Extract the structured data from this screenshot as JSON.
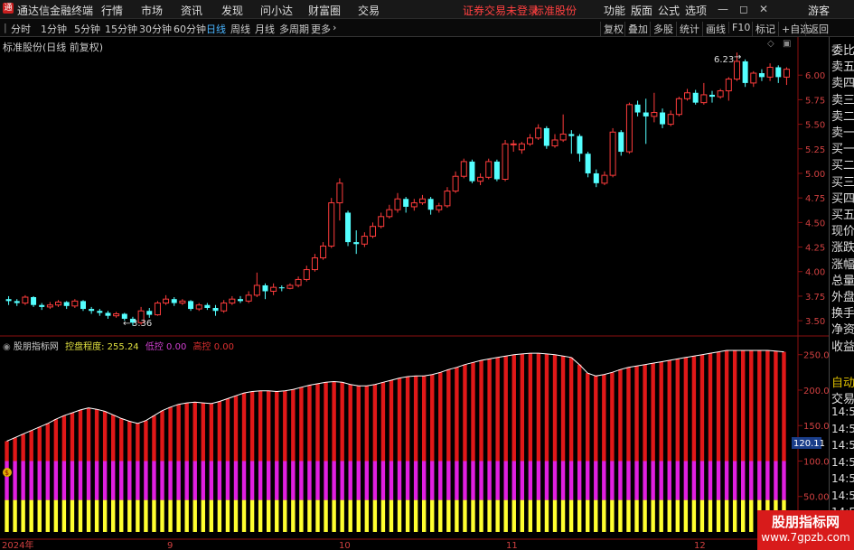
{
  "menubar": {
    "app_title": "通达信金融终端",
    "items": [
      "行情",
      "市场",
      "资讯",
      "发现",
      "问小达",
      "财富圈",
      "交易"
    ],
    "notice": "证券交易未登录",
    "stock_name": "标准股份",
    "right_items": [
      "功能",
      "版面",
      "公式",
      "选项"
    ],
    "guest": "游客"
  },
  "periods": {
    "items": [
      "分时",
      "1分钟",
      "5分钟",
      "15分钟",
      "30分钟",
      "60分钟",
      "日线",
      "周线",
      "月线",
      "多周期",
      "更多"
    ],
    "active": "日线"
  },
  "tools": [
    "复权",
    "叠加",
    "多股",
    "统计",
    "画线",
    "F10",
    "标记",
    "+自选",
    "返回"
  ],
  "price_chart": {
    "header": "标准股份(日线 前复权)",
    "high_label": "6.23",
    "low_label": "3.36",
    "y_ticks": [
      "6.00",
      "5.75",
      "5.50",
      "5.25",
      "5.00",
      "4.75",
      "4.50",
      "4.25",
      "4.00",
      "3.75",
      "3.50"
    ]
  },
  "indicator": {
    "name": "股朋指标网",
    "kpcd_label": "控盘程度:",
    "kpcd_value": "255.24",
    "low_label": "低控",
    "low_value": "0.00",
    "high_label": "高控",
    "high_value": "0.00",
    "y_ticks": [
      "250.0",
      "200.0",
      "150.0",
      "100.0",
      "50.00"
    ],
    "current_tag": "120.11"
  },
  "x_labels": [
    "2024年",
    "9",
    "10",
    "11",
    "12"
  ],
  "sidebar": {
    "items": [
      "委比",
      "卖五",
      "卖四",
      "卖三",
      "卖二",
      "卖一",
      "买一",
      "买二",
      "买三",
      "买四",
      "买五",
      "现价",
      "涨跌",
      "涨幅",
      "总量",
      "外盘",
      "换手",
      "净资",
      "收益"
    ],
    "bottom_items": [
      "自动",
      "交易"
    ],
    "times": [
      "14:56",
      "14:56",
      "14:56",
      "14:56",
      "14:56",
      "14:56",
      "14:56"
    ]
  },
  "watermark": {
    "line1": "股朋指标网",
    "line2": "www.7gpzb.com"
  },
  "chart_data": {
    "type": "candlestick",
    "candles": [
      [
        3.72,
        3.7,
        3.75,
        3.66
      ],
      [
        3.7,
        3.68,
        3.72,
        3.65
      ],
      [
        3.68,
        3.74,
        3.76,
        3.66
      ],
      [
        3.74,
        3.66,
        3.75,
        3.64
      ],
      [
        3.66,
        3.64,
        3.68,
        3.61
      ],
      [
        3.64,
        3.66,
        3.69,
        3.62
      ],
      [
        3.66,
        3.69,
        3.71,
        3.64
      ],
      [
        3.69,
        3.65,
        3.7,
        3.62
      ],
      [
        3.65,
        3.7,
        3.72,
        3.63
      ],
      [
        3.7,
        3.62,
        3.71,
        3.6
      ],
      [
        3.62,
        3.6,
        3.64,
        3.57
      ],
      [
        3.6,
        3.58,
        3.62,
        3.55
      ],
      [
        3.58,
        3.55,
        3.6,
        3.52
      ],
      [
        3.55,
        3.57,
        3.59,
        3.53
      ],
      [
        3.57,
        3.52,
        3.58,
        3.5
      ],
      [
        3.52,
        3.48,
        3.54,
        3.45
      ],
      [
        3.48,
        3.6,
        3.64,
        3.46
      ],
      [
        3.6,
        3.56,
        3.63,
        3.53
      ],
      [
        3.56,
        3.68,
        3.7,
        3.55
      ],
      [
        3.68,
        3.72,
        3.76,
        3.66
      ],
      [
        3.72,
        3.68,
        3.74,
        3.65
      ],
      [
        3.68,
        3.7,
        3.72,
        3.66
      ],
      [
        3.7,
        3.62,
        3.71,
        3.6
      ],
      [
        3.62,
        3.66,
        3.68,
        3.6
      ],
      [
        3.66,
        3.63,
        3.68,
        3.61
      ],
      [
        3.63,
        3.6,
        3.66,
        3.55
      ],
      [
        3.6,
        3.68,
        3.71,
        3.58
      ],
      [
        3.68,
        3.72,
        3.75,
        3.66
      ],
      [
        3.72,
        3.7,
        3.75,
        3.68
      ],
      [
        3.7,
        3.76,
        3.8,
        3.68
      ],
      [
        3.76,
        3.86,
        3.99,
        3.74
      ],
      [
        3.86,
        3.8,
        3.88,
        3.72
      ],
      [
        3.8,
        3.84,
        3.88,
        3.76
      ],
      [
        3.84,
        3.83,
        3.86,
        3.8
      ],
      [
        3.83,
        3.86,
        3.88,
        3.82
      ],
      [
        3.86,
        3.92,
        3.95,
        3.84
      ],
      [
        3.92,
        4.02,
        4.06,
        3.9
      ],
      [
        4.02,
        4.14,
        4.18,
        4.0
      ],
      [
        4.14,
        4.26,
        4.3,
        4.12
      ],
      [
        4.26,
        4.7,
        4.75,
        4.24
      ],
      [
        4.7,
        4.9,
        4.95,
        4.52
      ],
      [
        4.6,
        4.3,
        4.62,
        4.26
      ],
      [
        4.3,
        4.28,
        4.42,
        4.18
      ],
      [
        4.28,
        4.36,
        4.4,
        4.25
      ],
      [
        4.36,
        4.46,
        4.5,
        4.34
      ],
      [
        4.46,
        4.56,
        4.6,
        4.44
      ],
      [
        4.56,
        4.63,
        4.68,
        4.54
      ],
      [
        4.63,
        4.74,
        4.8,
        4.6
      ],
      [
        4.74,
        4.66,
        4.76,
        4.6
      ],
      [
        4.66,
        4.7,
        4.74,
        4.62
      ],
      [
        4.7,
        4.74,
        4.78,
        4.68
      ],
      [
        4.74,
        4.63,
        4.76,
        4.58
      ],
      [
        4.63,
        4.67,
        4.7,
        4.6
      ],
      [
        4.67,
        4.82,
        4.86,
        4.65
      ],
      [
        4.82,
        4.97,
        5.02,
        4.8
      ],
      [
        4.97,
        5.12,
        5.15,
        4.95
      ],
      [
        5.12,
        4.92,
        5.14,
        4.9
      ],
      [
        4.92,
        4.96,
        5.0,
        4.88
      ],
      [
        4.96,
        5.12,
        5.15,
        4.94
      ],
      [
        5.12,
        4.94,
        5.14,
        4.92
      ],
      [
        4.94,
        5.3,
        5.34,
        4.92
      ],
      [
        5.3,
        5.3,
        5.34,
        5.22
      ],
      [
        5.24,
        5.3,
        5.32,
        5.2
      ],
      [
        5.3,
        5.36,
        5.4,
        5.28
      ],
      [
        5.36,
        5.46,
        5.5,
        5.34
      ],
      [
        5.46,
        5.28,
        5.48,
        5.25
      ],
      [
        5.28,
        5.34,
        5.4,
        5.26
      ],
      [
        5.34,
        5.4,
        5.6,
        5.32
      ],
      [
        5.4,
        5.38,
        5.44,
        5.2
      ],
      [
        5.38,
        5.2,
        5.4,
        5.12
      ],
      [
        5.2,
        5.0,
        5.22,
        4.96
      ],
      [
        5.0,
        4.9,
        5.04,
        4.86
      ],
      [
        4.9,
        4.98,
        5.02,
        4.88
      ],
      [
        4.98,
        5.42,
        5.46,
        4.96
      ],
      [
        5.42,
        5.22,
        5.44,
        5.18
      ],
      [
        5.22,
        5.7,
        5.72,
        5.2
      ],
      [
        5.7,
        5.62,
        5.74,
        5.58
      ],
      [
        5.62,
        5.58,
        5.76,
        5.3
      ],
      [
        5.58,
        5.62,
        5.82,
        5.52
      ],
      [
        5.62,
        5.5,
        5.66,
        5.46
      ],
      [
        5.5,
        5.6,
        5.64,
        5.48
      ],
      [
        5.6,
        5.76,
        5.78,
        5.58
      ],
      [
        5.76,
        5.82,
        5.86,
        5.74
      ],
      [
        5.82,
        5.72,
        5.85,
        5.7
      ],
      [
        5.72,
        5.8,
        5.92,
        5.7
      ],
      [
        5.8,
        5.78,
        5.84,
        5.72
      ],
      [
        5.78,
        5.84,
        5.86,
        5.76
      ],
      [
        5.84,
        5.96,
        5.98,
        5.74
      ],
      [
        5.96,
        6.14,
        6.23,
        5.94
      ],
      [
        6.14,
        5.92,
        6.16,
        5.88
      ],
      [
        5.92,
        6.02,
        6.04,
        5.88
      ],
      [
        6.02,
        5.98,
        6.06,
        5.94
      ],
      [
        5.98,
        6.08,
        6.12,
        5.94
      ],
      [
        6.08,
        5.98,
        6.1,
        5.92
      ],
      [
        5.98,
        6.06,
        6.08,
        5.9
      ]
    ],
    "indicator_values": [
      128,
      133,
      138,
      143,
      148,
      153,
      159,
      164,
      168,
      172,
      175,
      173,
      170,
      165,
      160,
      156,
      153,
      157,
      164,
      171,
      176,
      180,
      182,
      183,
      182,
      181,
      184,
      188,
      192,
      196,
      198,
      199,
      199,
      198,
      199,
      201,
      204,
      207,
      209,
      211,
      212,
      211,
      208,
      206,
      206,
      208,
      211,
      214,
      217,
      219,
      220,
      220,
      222,
      225,
      229,
      232,
      236,
      239,
      242,
      244,
      246,
      248,
      250,
      251,
      252,
      252,
      251,
      250,
      248,
      246,
      236,
      224,
      220,
      222,
      225,
      229,
      232,
      234,
      236,
      238,
      240,
      242,
      244,
      246,
      248,
      250,
      252,
      254,
      256,
      256,
      256,
      256,
      256,
      256,
      255,
      254
    ],
    "indicator_ylim": [
      0,
      270
    ]
  }
}
